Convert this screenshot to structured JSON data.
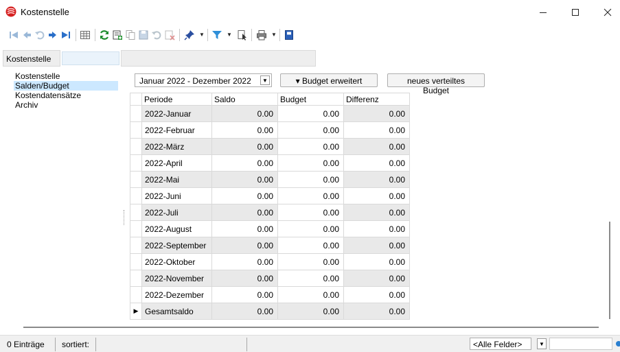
{
  "window": {
    "title": "Kostenstelle",
    "icon": "app-logo-icon",
    "controls": [
      "minimize-icon",
      "maximize-icon",
      "close-icon"
    ]
  },
  "toolbar": {
    "icons": [
      "first-record-icon",
      "previous-record-icon",
      "undo-icon",
      "next-record-icon",
      "last-record-icon",
      "table-view-icon",
      "refresh-icon",
      "new-record-icon",
      "copy-record-icon",
      "save-icon",
      "undo-changes-icon",
      "delete-icon",
      "pin-icon",
      "filter-icon",
      "select-icon",
      "print-icon",
      "exit-icon"
    ]
  },
  "filter": {
    "label": "Kostenstelle",
    "value": ""
  },
  "navigation": {
    "items": [
      {
        "label": "Kostenstelle",
        "selected": false
      },
      {
        "label": "Salden/Budget",
        "selected": true
      },
      {
        "label": "Kostendatensätze",
        "selected": false
      },
      {
        "label": "Archiv",
        "selected": false
      }
    ]
  },
  "controls": {
    "period": "Januar 2022 - Dezember 2022",
    "budget_button": "▾ Budget erweitert",
    "distributed_button": "neues verteiltes Budget"
  },
  "table": {
    "columns": [
      "Periode",
      "Saldo",
      "Budget",
      "Differenz"
    ],
    "rows": [
      {
        "periode": "2022-Januar",
        "saldo": "0.00",
        "budget": "0.00",
        "differenz": "0.00"
      },
      {
        "periode": "2022-Februar",
        "saldo": "0.00",
        "budget": "0.00",
        "differenz": "0.00"
      },
      {
        "periode": "2022-März",
        "saldo": "0.00",
        "budget": "0.00",
        "differenz": "0.00"
      },
      {
        "periode": "2022-April",
        "saldo": "0.00",
        "budget": "0.00",
        "differenz": "0.00"
      },
      {
        "periode": "2022-Mai",
        "saldo": "0.00",
        "budget": "0.00",
        "differenz": "0.00"
      },
      {
        "periode": "2022-Juni",
        "saldo": "0.00",
        "budget": "0.00",
        "differenz": "0.00"
      },
      {
        "periode": "2022-Juli",
        "saldo": "0.00",
        "budget": "0.00",
        "differenz": "0.00"
      },
      {
        "periode": "2022-August",
        "saldo": "0.00",
        "budget": "0.00",
        "differenz": "0.00"
      },
      {
        "periode": "2022-September",
        "saldo": "0.00",
        "budget": "0.00",
        "differenz": "0.00"
      },
      {
        "periode": "2022-Oktober",
        "saldo": "0.00",
        "budget": "0.00",
        "differenz": "0.00"
      },
      {
        "periode": "2022-November",
        "saldo": "0.00",
        "budget": "0.00",
        "differenz": "0.00"
      },
      {
        "periode": "2022-Dezember",
        "saldo": "0.00",
        "budget": "0.00",
        "differenz": "0.00"
      }
    ],
    "total": {
      "periode": "Gesamtsaldo",
      "saldo": "0.00",
      "budget": "0.00",
      "differenz": "0.00"
    }
  },
  "status": {
    "entries": "0 Einträge",
    "sorted": "sortiert:",
    "field_select": "<Alle Felder>",
    "search_value": ""
  },
  "colors": {
    "selected_nav": "#cce8ff",
    "readonly_cell": "#e9e9e9",
    "filter_input": "#eaf3fb"
  }
}
